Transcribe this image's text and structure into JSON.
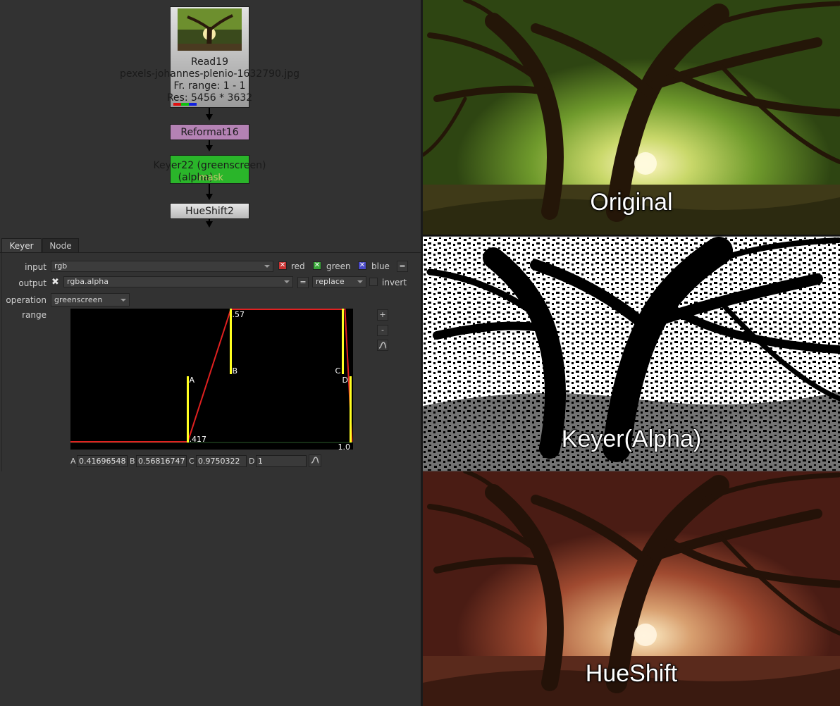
{
  "graph": {
    "read": {
      "name": "Read19",
      "file": "pexels-johannes-plenio-1632790.jpg",
      "frame_range": "Fr. range: 1 - 1",
      "resolution": "Res: 5456 * 3632"
    },
    "reformat": {
      "name": "Reformat16"
    },
    "keyer": {
      "name": "Keyer22 (greenscreen)",
      "sub": "(alpha)",
      "mask": "mask"
    },
    "hueshift": {
      "name": "HueShift2"
    }
  },
  "tabs": {
    "keyer": "Keyer",
    "node": "Node"
  },
  "keyer": {
    "input_label": "input",
    "input_value": "rgb",
    "red": "red",
    "green": "green",
    "blue": "blue",
    "eq": "=",
    "output_label": "output",
    "output_value": "rgba.alpha",
    "replace": "replace",
    "invert": "invert",
    "operation_label": "operation",
    "operation_value": "greenscreen",
    "range_label": "range",
    "plus": "+",
    "minus": "-",
    "A_label": "A",
    "A_value": "0.41696548",
    "B_label": "B",
    "B_value": "0.56816747",
    "C_label": "C",
    "C_value": "0.9750322",
    "D_label": "D",
    "D_value": "1"
  },
  "curve": {
    "points": {
      "A": 0.417,
      "B": 0.568,
      "C": 0.975,
      "D": 1.0
    },
    "marks": {
      "A": "A",
      "B": "B",
      "C": "C",
      "D": "D",
      "top": ".57",
      "bottom": ".417",
      "end": "1.0"
    }
  },
  "viewer": {
    "original": "Original",
    "keyer": "Keyer(Alpha)",
    "hueshift": "HueShift"
  },
  "colors": {
    "read_node": "#c8c8c8",
    "reformat_node": "#b482b4",
    "keyer_node": "#2ab52a",
    "hueshift_node": "#d0d0d0",
    "curve_line": "#e02020",
    "curve_handle": "#ffff20"
  }
}
